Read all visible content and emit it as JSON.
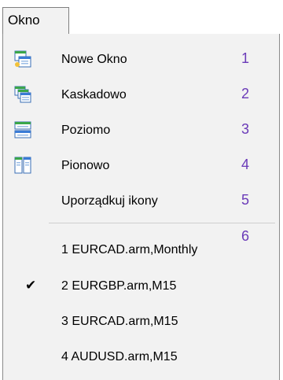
{
  "menu": {
    "title": "Okno",
    "items": [
      {
        "label": "Nowe Okno",
        "number": "1",
        "icon": "new-window-icon"
      },
      {
        "label": "Kaskadowo",
        "number": "2",
        "icon": "cascade-icon"
      },
      {
        "label": "Poziomo",
        "number": "3",
        "icon": "tile-horizontal-icon"
      },
      {
        "label": "Pionowo",
        "number": "4",
        "icon": "tile-vertical-icon"
      },
      {
        "label": "Uporządkuj ikony",
        "number": "5",
        "icon": ""
      }
    ],
    "separator_number": "6",
    "windows": [
      {
        "label": "1 EURCAD.arm,Monthly",
        "checked": false
      },
      {
        "label": "2 EURGBP.arm,M15",
        "checked": true
      },
      {
        "label": "3 EURCAD.arm,M15",
        "checked": false
      },
      {
        "label": "4 AUDUSD.arm,M15",
        "checked": false
      }
    ],
    "check_glyph": "✔",
    "colors": {
      "number": "#6a3ab8",
      "menu_bg": "#f2f2f2",
      "icon_blue": "#3a7bd5",
      "icon_green": "#3aa64a",
      "icon_yellow": "#f2c23a"
    }
  }
}
